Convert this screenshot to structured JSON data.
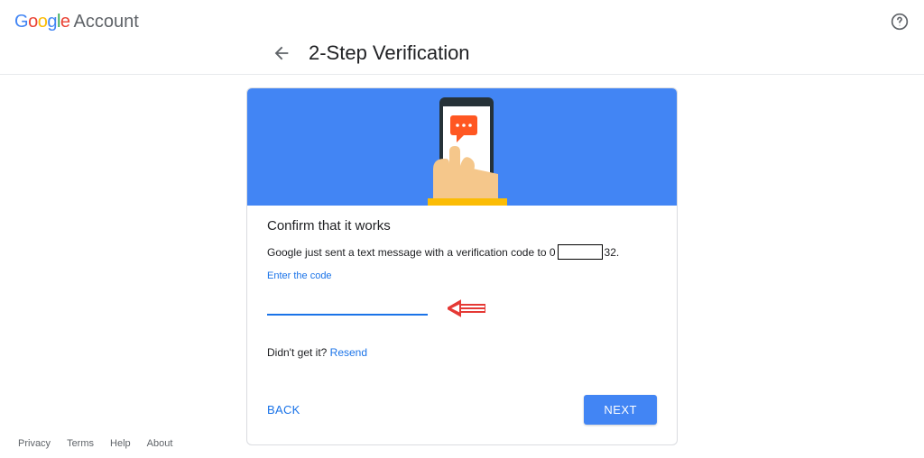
{
  "header": {
    "brand_suffix": "Account"
  },
  "page": {
    "title": "2-Step Verification"
  },
  "card": {
    "heading": "Confirm that it works",
    "sent_pre": "Google just sent a text message with a verification code to 0",
    "sent_post": "32.",
    "enter_label": "Enter the code",
    "didnt": "Didn't get it? ",
    "resend": "Resend",
    "back": "BACK",
    "next": "NEXT"
  },
  "footer": {
    "privacy": "Privacy",
    "terms": "Terms",
    "help": "Help",
    "about": "About"
  }
}
